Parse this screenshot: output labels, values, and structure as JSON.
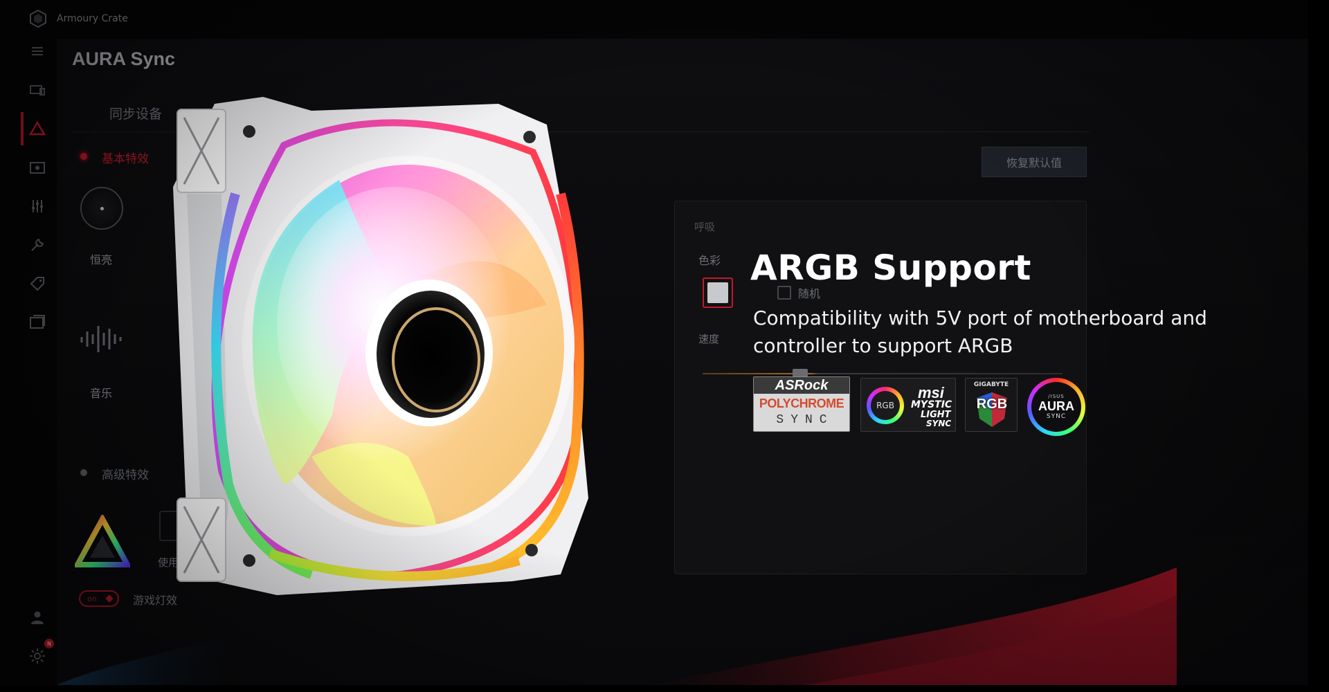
{
  "titlebar": {
    "app_name": "Armoury Crate"
  },
  "page": {
    "title": "AURA Sync"
  },
  "tabs": {
    "sync_devices": "同步设备"
  },
  "basic_effects": {
    "label": "基本特效",
    "static_label": "恒亮",
    "music_label": "音乐"
  },
  "advanced_effects": {
    "label": "高级特效",
    "use_label": "使用",
    "toggle_value": "on",
    "game_lighting_label": "游戏灯效"
  },
  "actions": {
    "restore_default": "恢复默认值"
  },
  "settings_panel": {
    "effect_name": "呼吸",
    "color_label": "色彩",
    "random_label": "随机",
    "speed_label": "速度",
    "selected_color": "#c8c9cc",
    "random_checked": false
  },
  "hero": {
    "title": "ARGB Support",
    "subtitle": "Compatibility with 5V port of motherboard and controller to support ARGB"
  },
  "partner_logos": {
    "asrock": {
      "brand": "ASRock",
      "line1": "POLYCHROME",
      "line2": "SYNC"
    },
    "msi": {
      "ring_text": "RGB",
      "brand": "msi",
      "line1": "MYSTIC",
      "line2": "LIGHT",
      "line3": "SYNC"
    },
    "gigabyte": {
      "brand": "GIGABYTE",
      "text": "RGB"
    },
    "asus": {
      "top": "/ISUS",
      "main": "AURA",
      "bottom": "SYNC"
    }
  },
  "sidebar": {
    "items": [
      "menu-icon",
      "device-icon",
      "aura-icon",
      "media-icon",
      "sliders-icon",
      "wrench-icon",
      "tag-icon",
      "library-icon"
    ],
    "bottom": [
      "user-icon",
      "settings-icon"
    ],
    "notification_badge": "N"
  },
  "colors": {
    "accent": "#c3182a",
    "background": "#0a0a0c",
    "text_muted": "#6d7077"
  }
}
